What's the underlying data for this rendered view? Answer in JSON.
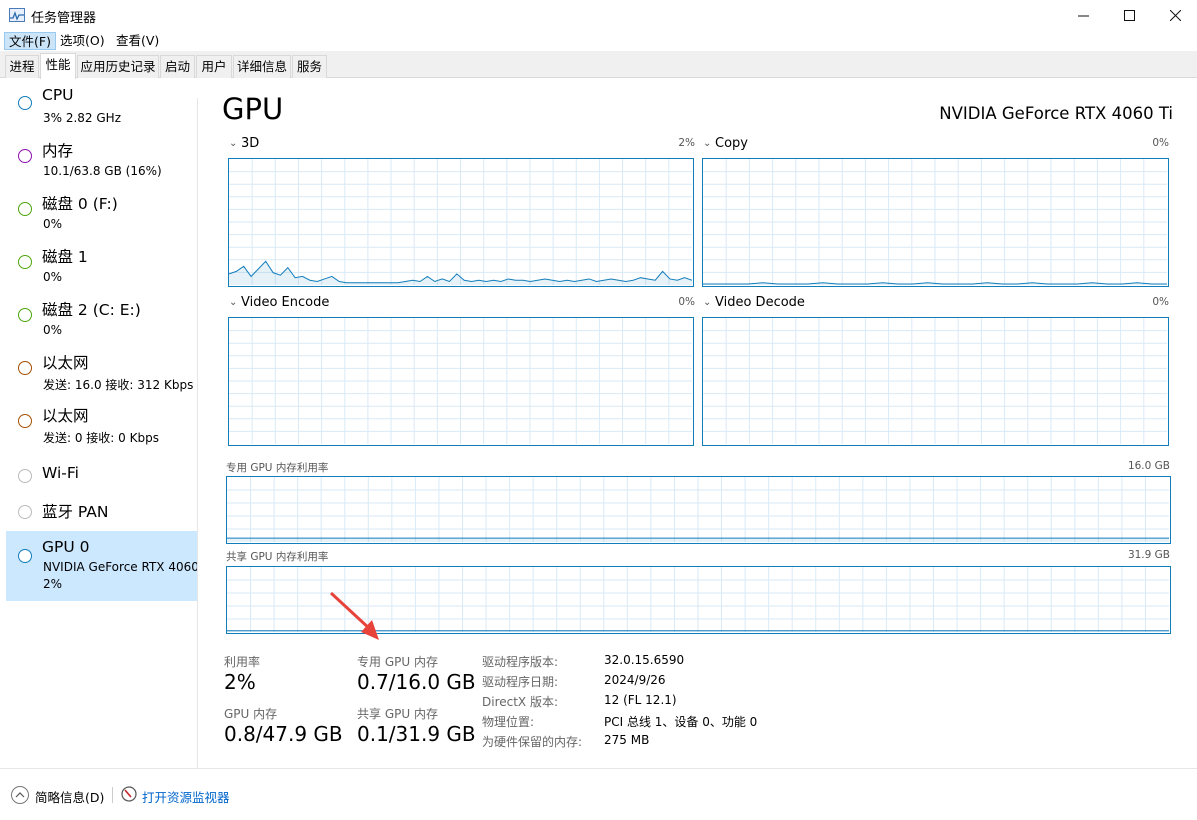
{
  "window": {
    "title": "任务管理器",
    "minimize": "—",
    "maximize": "☐",
    "close": "✕"
  },
  "menu": [
    {
      "label": "文件(F)",
      "active": true
    },
    {
      "label": "选项(O)",
      "active": false
    },
    {
      "label": "查看(V)",
      "active": false
    }
  ],
  "tabs": [
    {
      "label": "进程"
    },
    {
      "label": "性能",
      "active": true
    },
    {
      "label": "应用历史记录"
    },
    {
      "label": "启动"
    },
    {
      "label": "用户"
    },
    {
      "label": "详细信息"
    },
    {
      "label": "服务"
    }
  ],
  "sidebar": [
    {
      "name": "CPU",
      "sub": "3% 2.82 GHz",
      "color": "#117dbb"
    },
    {
      "name": "内存",
      "sub": "10.1/63.8 GB (16%)",
      "color": "#8b12ae"
    },
    {
      "name": "磁盘 0 (F:)",
      "sub": "0%",
      "color": "#4da60c"
    },
    {
      "name": "磁盘 1",
      "sub": "0%",
      "color": "#4da60c"
    },
    {
      "name": "磁盘 2 (C: E:)",
      "sub": "0%",
      "color": "#4da60c"
    },
    {
      "name": "以太网",
      "sub": "发送: 16.0 接收: 312 Kbps",
      "color": "#a74f01"
    },
    {
      "name": "以太网",
      "sub": "发送: 0 接收: 0 Kbps",
      "color": "#a74f01"
    },
    {
      "name": "Wi-Fi",
      "sub": "",
      "color": "#bbbbbb"
    },
    {
      "name": "蓝牙 PAN",
      "sub": "",
      "color": "#bbbbbb"
    },
    {
      "name": "GPU 0",
      "sub": "NVIDIA GeForce RTX 4060",
      "sub2": "2%",
      "color": "#117dbb",
      "selected": true
    }
  ],
  "main": {
    "title": "GPU",
    "model": "NVIDIA GeForce RTX 4060 Ti",
    "engines": [
      {
        "label": "3D",
        "pct": "2%"
      },
      {
        "label": "Copy",
        "pct": "0%"
      },
      {
        "label": "Video Encode",
        "pct": "0%"
      },
      {
        "label": "Video Decode",
        "pct": "0%"
      }
    ],
    "dedicated": {
      "label": "专用 GPU 内存利用率",
      "max": "16.0 GB"
    },
    "shared": {
      "label": "共享 GPU 内存利用率",
      "max": "31.9 GB"
    },
    "graph_3d_values": [
      8,
      10,
      14,
      6,
      12,
      18,
      9,
      7,
      13,
      5,
      6,
      3,
      2,
      4,
      6,
      2,
      1,
      1,
      1,
      1,
      1,
      1,
      1,
      1,
      2,
      3,
      2,
      6,
      2,
      4,
      2,
      8,
      3,
      2,
      3,
      2,
      3,
      2,
      4,
      3,
      3,
      2,
      3,
      4,
      3,
      2,
      3,
      2,
      3,
      4,
      2,
      3,
      4,
      3,
      2,
      3,
      5,
      4,
      3,
      10,
      4,
      3,
      5,
      3
    ],
    "graph_copy_values": [
      0,
      0,
      0,
      0,
      1,
      0,
      0,
      0,
      1,
      0,
      0,
      0,
      1,
      0,
      0,
      1,
      0,
      0,
      0,
      1,
      0,
      0,
      1,
      0,
      0,
      0,
      1,
      0,
      0,
      1,
      0,
      0
    ],
    "dedicated_values": [
      4.4,
      4.4,
      4.4,
      4.4,
      4.4,
      4.4,
      4.4,
      4.4,
      4.4,
      4.4,
      4.4,
      4.4,
      4.4,
      4.4,
      4.4,
      4.4,
      4.4,
      4.4,
      4.4,
      4.4,
      4.4,
      4.4,
      4.4,
      4.4,
      4.4,
      4.4,
      4.4,
      4.4,
      4.4,
      4.4,
      4.4,
      4.4,
      4.4,
      4.4,
      4.4,
      4.4,
      4.4,
      4.4,
      4.4,
      4.4,
      4.4,
      4.4,
      4.4,
      4.4,
      4.4,
      4.4,
      4.4,
      4.4,
      4.4,
      4.4
    ],
    "shared_values": [
      0.3,
      0.3,
      0.3,
      0.3,
      0.3,
      0.3,
      0.3,
      0.3,
      0.3,
      0.3,
      0.3,
      0.3,
      0.3,
      0.3,
      0.3,
      0.3,
      0.3,
      0.3,
      0.3,
      0.3,
      0.3,
      0.3,
      0.3,
      0.3,
      0.3,
      0.3,
      0.3,
      0.3,
      0.3,
      0.3
    ]
  },
  "stats": {
    "util_label": "利用率",
    "util_value": "2%",
    "ded_label": "专用 GPU 内存",
    "ded_value": "0.7/16.0 GB",
    "gpu_mem_label": "GPU 内存",
    "gpu_mem_value": "0.8/47.9 GB",
    "shared_label": "共享 GPU 内存",
    "shared_value": "0.1/31.9 GB"
  },
  "info": [
    {
      "label": "驱动程序版本:",
      "value": "32.0.15.6590"
    },
    {
      "label": "驱动程序日期:",
      "value": "2024/9/26"
    },
    {
      "label": "DirectX 版本:",
      "value": "12 (FL 12.1)"
    },
    {
      "label": "物理位置:",
      "value": "PCI 总线 1、设备 0、功能 0"
    },
    {
      "label": "为硬件保留的内存:",
      "value": "275 MB"
    }
  ],
  "footer": {
    "brief": "简略信息(D)",
    "monitor_link": "打开资源监视器"
  },
  "colors": {
    "graph_line": "#117dbb",
    "graph_grid": "#d9eaf7",
    "annotation": "#e8433a"
  }
}
